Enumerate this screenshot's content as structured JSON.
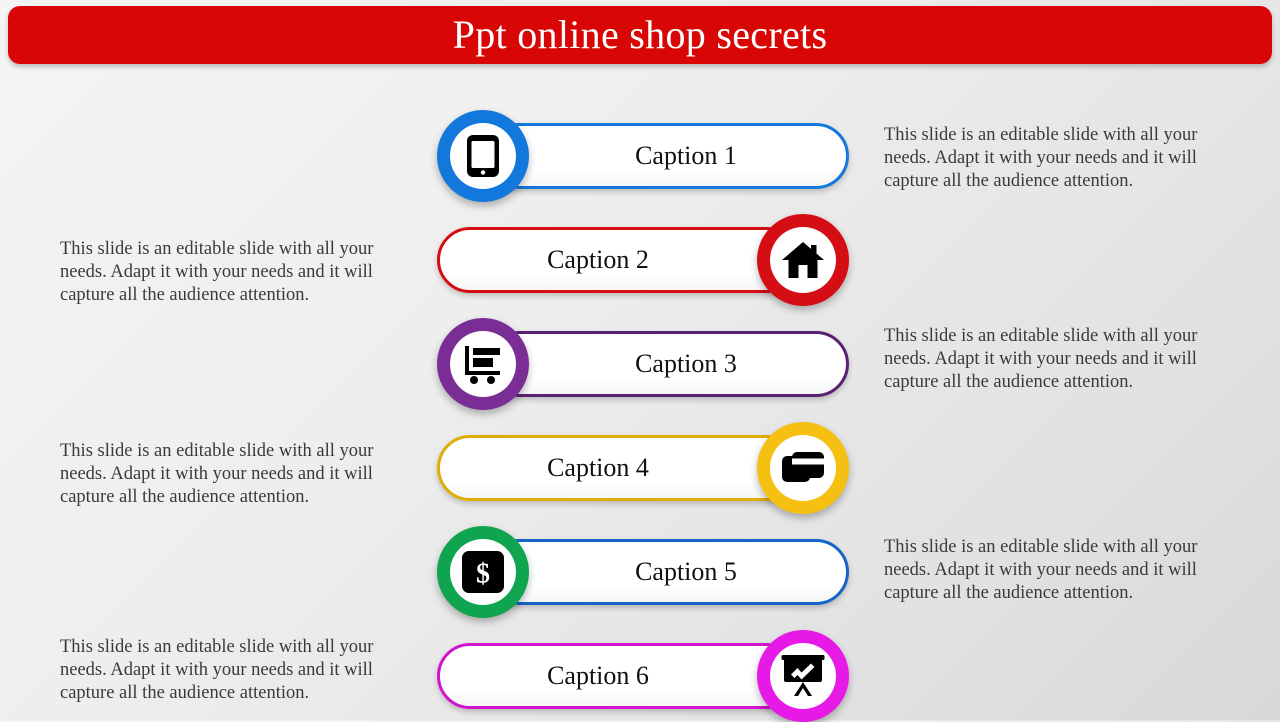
{
  "title": "Ppt online shop secrets",
  "theme": {
    "banner_color": "#d90606",
    "background_from": "#f4f4f4",
    "background_to": "#d8d8d8",
    "caption_text_color": "#111111",
    "paragraph_text_color": "#3a3a3a"
  },
  "body_text": "This slide is an editable slide with all your needs. Adapt it with your needs and it will capture all the audience attention.",
  "rows": [
    {
      "caption": "Caption 1",
      "icon": "smartphone-icon",
      "icon_side": "left",
      "badge_color": "#1378dc",
      "pill_border_color": "#1378dc"
    },
    {
      "caption": "Caption 2",
      "icon": "home-icon",
      "icon_side": "right",
      "badge_color": "#d50d15",
      "pill_border_color": "#d50d15"
    },
    {
      "caption": "Caption 3",
      "icon": "shopping-cart-icon",
      "icon_side": "left",
      "badge_color": "#7b2d96",
      "pill_border_color": "#5b1f73"
    },
    {
      "caption": "Caption 4",
      "icon": "credit-card-icon",
      "icon_side": "right",
      "badge_color": "#f5c012",
      "pill_border_color": "#e0ad06"
    },
    {
      "caption": "Caption 5",
      "icon": "dollar-icon",
      "icon_side": "left",
      "badge_color": "#0fa450",
      "pill_border_color": "#1565c8"
    },
    {
      "caption": "Caption 6",
      "icon": "presentation-chart-icon",
      "icon_side": "right",
      "badge_color": "#e619e6",
      "pill_border_color": "#d413cf"
    }
  ],
  "paragraphs": [
    {
      "side": "right",
      "text": "This slide is an editable slide with all your needs. Adapt it with your needs and it will capture all the audience attention."
    },
    {
      "side": "left",
      "text": "This slide is an editable slide with all your needs. Adapt it with your needs and it will capture all the audience attention."
    },
    {
      "side": "right",
      "text": "This slide is an editable slide with all your needs. Adapt it with your needs and it will capture all the audience attention."
    },
    {
      "side": "left",
      "text": "This slide is an editable slide with all your needs. Adapt it with your needs and it will capture all the audience attention."
    },
    {
      "side": "right",
      "text": "This slide is an editable slide with all your needs. Adapt it with your needs and it will capture all the audience attention."
    },
    {
      "side": "left",
      "text": "This slide is an editable slide with all your needs. Adapt it with your needs and it will capture all the audience attention."
    }
  ]
}
